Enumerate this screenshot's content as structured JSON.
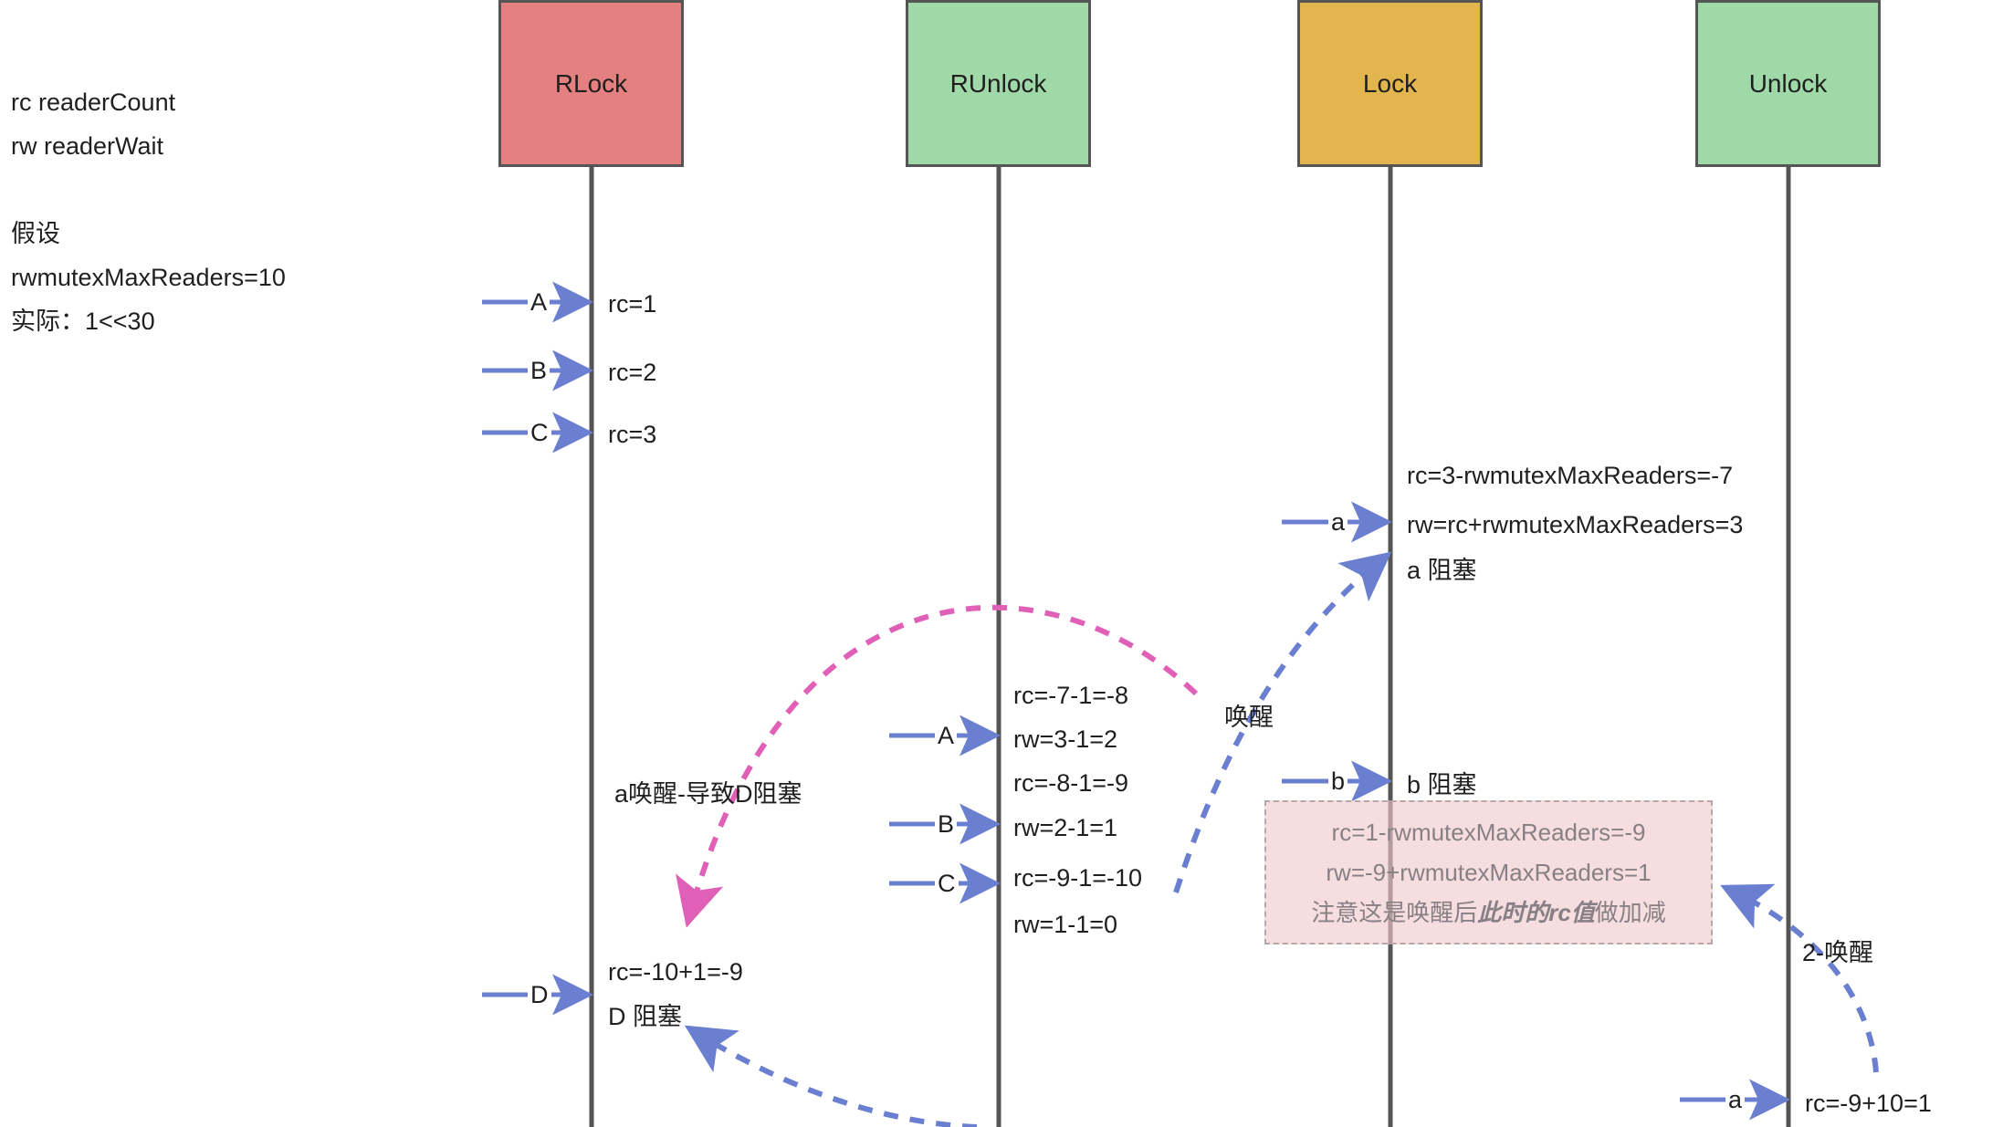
{
  "legend": {
    "lines": [
      "rc readerCount",
      "rw readerWait"
    ],
    "assumption_lines": [
      "假设",
      "rwmutexMaxReaders=10",
      "实际：1<<30"
    ]
  },
  "colors": {
    "rlock_fill": "#e58080",
    "runlock_fill": "#a0d9a8",
    "lock_fill": "#e2b54f",
    "unlock_fill": "#a0d9a8",
    "box_border": "#555555",
    "lifeline": "#555555",
    "message_arrow": "#6b7fd0",
    "wake_arrow": "#e060b8",
    "highlight_bg": "#f3d9dd",
    "highlight_text": "#878085"
  },
  "actors": [
    {
      "name": "RLock",
      "label": "RLock"
    },
    {
      "name": "RUnlock",
      "label": "RUnlock"
    },
    {
      "name": "Lock",
      "label": "Lock"
    },
    {
      "name": "Unlock",
      "label": "Unlock"
    }
  ],
  "messages": [
    {
      "id": "m1",
      "label": "A",
      "target": "RLock"
    },
    {
      "id": "m2",
      "label": "B",
      "target": "RLock"
    },
    {
      "id": "m3",
      "label": "C",
      "target": "RLock"
    },
    {
      "id": "m4",
      "label": "a",
      "target": "Lock"
    },
    {
      "id": "m5",
      "label": "A",
      "target": "RUnlock"
    },
    {
      "id": "m6",
      "label": "B",
      "target": "RUnlock"
    },
    {
      "id": "m7",
      "label": "b",
      "target": "Lock"
    },
    {
      "id": "m8",
      "label": "C",
      "target": "RUnlock"
    },
    {
      "id": "m9",
      "label": "D",
      "target": "RLock"
    },
    {
      "id": "m10",
      "label": "a",
      "target": "Unlock"
    }
  ],
  "notes": {
    "rlock_rc1": "rc=1",
    "rlock_rc2": "rc=2",
    "rlock_rc3": "rc=3",
    "lock_line1": "rc=3-rwmutexMaxReaders=-7",
    "lock_line2": "rw=rc+rwmutexMaxReaders=3",
    "lock_block_a": "a 阻塞",
    "runlock_l1": "rc=-7-1=-8",
    "runlock_l2": "rw=3-1=2",
    "runlock_l3": "rc=-8-1=-9",
    "runlock_l4": "rw=2-1=1",
    "runlock_l5": "rc=-9-1=-10",
    "runlock_l6": "rw=1-1=0",
    "lock_block_b": "b 阻塞",
    "rlock_d1": "rc=-10+1=-9",
    "rlock_d2": "D 阻塞",
    "unlock_rc": "rc=-9+10=1"
  },
  "highlight": {
    "line1": "rc=1-rwmutexMaxReaders=-9",
    "line2": "rw=-9+rwmutexMaxReaders=1",
    "line3_pre": "注意这是唤醒后",
    "line3_em": "此时的rc值",
    "line3_post": "做加减"
  },
  "curve_labels": {
    "wake": "唤醒",
    "a_wake_causes_d": "a唤醒-导致D阻塞",
    "wake2": "2-唤醒"
  }
}
